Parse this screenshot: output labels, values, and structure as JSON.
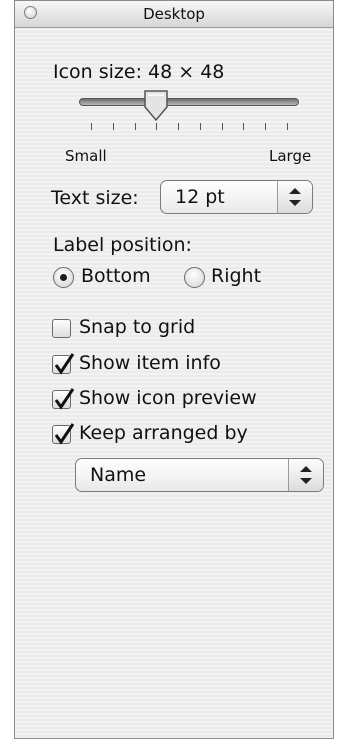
{
  "window": {
    "title": "Desktop"
  },
  "icon_size": {
    "label": "Icon size: 48 × 48",
    "value_fraction": 0.33,
    "min_label": "Small",
    "max_label": "Large",
    "tick_count": 10
  },
  "text_size": {
    "label": "Text size:",
    "value": "12 pt"
  },
  "label_position": {
    "label": "Label position:",
    "options": [
      "Bottom",
      "Right"
    ],
    "selected": "Bottom"
  },
  "options": [
    {
      "label": "Snap to grid",
      "checked": false
    },
    {
      "label": "Show item info",
      "checked": true
    },
    {
      "label": "Show icon preview",
      "checked": true
    },
    {
      "label": "Keep arranged by",
      "checked": true
    }
  ],
  "arrange_by": {
    "value": "Name"
  }
}
